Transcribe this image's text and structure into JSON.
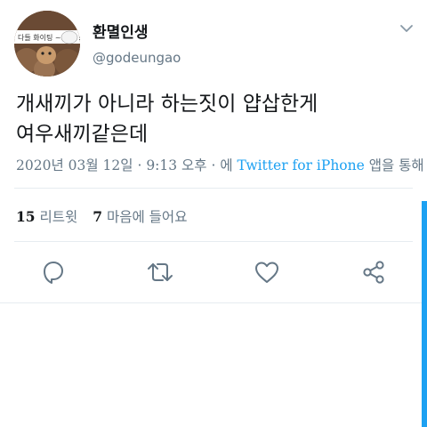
{
  "user": {
    "display_name": "환멸인생",
    "handle": "@godeungao",
    "avatar_caption": "다들 화이팅 ~~~ !!"
  },
  "tweet": {
    "text": "개새끼가 아니라 하는짓이 얍삽한게\n여우새끼같은데",
    "date": "2020년 03월 12일",
    "sep1": " · ",
    "time": "9:13 오후",
    "sep2": " · 에 ",
    "source": "Twitter for iPhone",
    "source_suffix": " 앱을 통해"
  },
  "stats": {
    "retweets_count": "15",
    "retweets_label": "리트윗",
    "likes_count": "7",
    "likes_label": "마음에 들어요"
  },
  "actions": [
    "reply-icon",
    "retweet-icon",
    "like-icon",
    "share-icon"
  ],
  "colors": {
    "accent": "#1da1f2",
    "secondary_text": "#657786",
    "icon": "#657786",
    "divider": "#e6ecf0"
  }
}
